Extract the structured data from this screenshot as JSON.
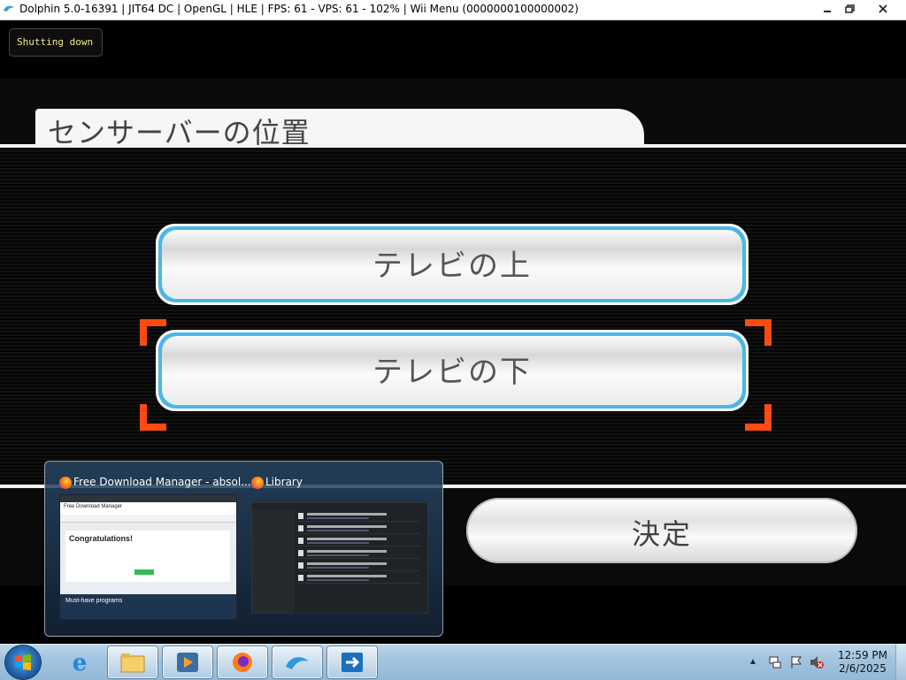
{
  "window": {
    "title": "Dolphin 5.0-16391 | JIT64 DC | OpenGL | HLE | FPS: 61 - VPS: 61 - 102% | Wii Menu (0000000100000002)",
    "minimize_icon": "minimize-icon",
    "maximize_icon": "maximize-icon",
    "close_icon": "close-icon"
  },
  "osd": {
    "message": "Shutting down"
  },
  "wii_menu": {
    "header": "センサーバーの位置",
    "options": [
      {
        "label": "テレビの上",
        "selected": false
      },
      {
        "label": "テレビの下",
        "selected": true
      }
    ],
    "confirm_label": "決定",
    "accent_color": "#49b7e6",
    "selection_color": "#ff4a12"
  },
  "thumbnails": [
    {
      "caption": "Free Download Manager - absol...",
      "page_header": "Free Download Manager",
      "page_heading": "Congratulations!",
      "page_section": "Must-have programs"
    },
    {
      "caption": "Library"
    }
  ],
  "taskbar": {
    "items": [
      "windows-start-icon",
      "internet-explorer-icon",
      "file-explorer-icon",
      "media-center-icon",
      "firefox-icon",
      "dolphin-icon",
      "free-download-manager-icon"
    ],
    "clock_time": "12:59 PM",
    "clock_date": "2/6/2025"
  }
}
